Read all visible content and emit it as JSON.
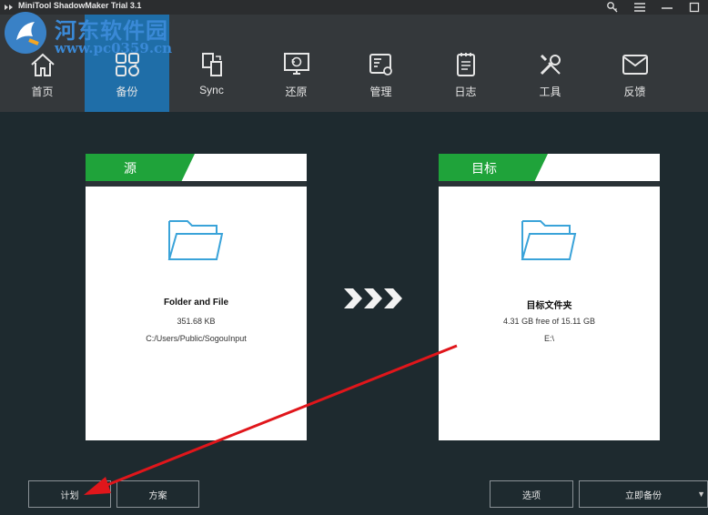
{
  "window": {
    "title": "MiniTool ShadowMaker Trial 3.1",
    "controls": [
      {
        "name": "key-icon",
        "symbol": "⚿"
      },
      {
        "name": "menu-icon",
        "symbol": "☰"
      },
      {
        "name": "minimize-icon",
        "symbol": "—"
      },
      {
        "name": "maximize-icon",
        "symbol": "☐"
      }
    ]
  },
  "watermark": {
    "text": "河东软件园",
    "url": "www.pc0359.cn"
  },
  "nav": {
    "items": [
      {
        "label": "首页",
        "icon": "home-icon"
      },
      {
        "label": "备份",
        "icon": "backup-icon",
        "active": true
      },
      {
        "label": "Sync",
        "icon": "sync-icon"
      },
      {
        "label": "还原",
        "icon": "restore-icon"
      },
      {
        "label": "管理",
        "icon": "manage-icon"
      },
      {
        "label": "日志",
        "icon": "log-icon"
      },
      {
        "label": "工具",
        "icon": "tools-icon"
      },
      {
        "label": "反馈",
        "icon": "feedback-icon"
      }
    ]
  },
  "source": {
    "tab_label": "源",
    "title": "Folder and File",
    "size": "351.68 KB",
    "path": "C:/Users/Public/SogouInput"
  },
  "destination": {
    "tab_label": "目标",
    "title": "目标文件夹",
    "free": "4.31 GB free of 15.11 GB",
    "path": "E:\\"
  },
  "buttons": {
    "schedule": "计划",
    "scheme": "方案",
    "options": "选项",
    "backup_now": "立即备份"
  },
  "colors": {
    "accent_green": "#1fa33a",
    "active_nav": "#1f6ea8",
    "annotation_red": "#e0161b"
  }
}
